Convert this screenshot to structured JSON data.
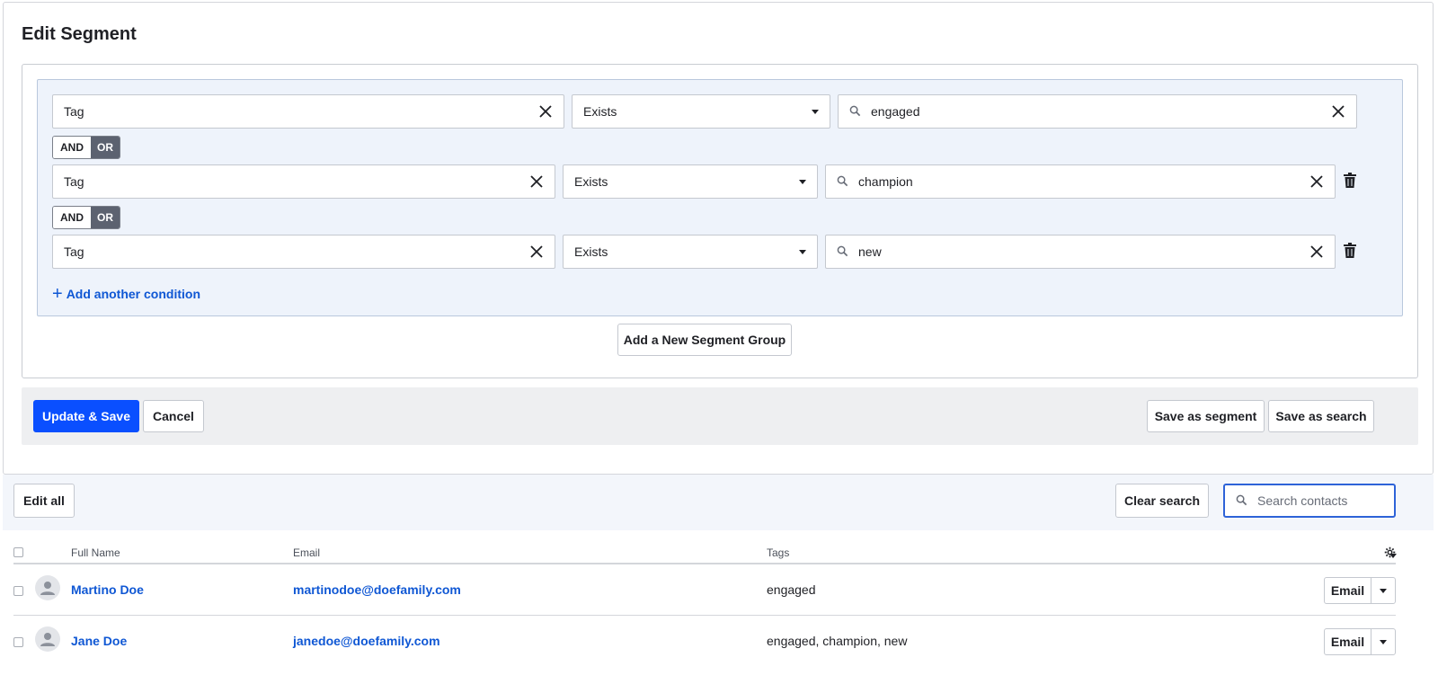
{
  "panel": {
    "title": "Edit Segment"
  },
  "conditions": [
    {
      "field": "Tag",
      "operator": "Exists",
      "value": "engaged"
    },
    {
      "field": "Tag",
      "operator": "Exists",
      "value": "champion"
    },
    {
      "field": "Tag",
      "operator": "Exists",
      "value": "new"
    }
  ],
  "logic": {
    "and_label": "AND",
    "or_label": "OR",
    "selected": "OR"
  },
  "add_condition_label": "Add another condition",
  "add_group_label": "Add a New Segment Group",
  "footer": {
    "update_label": "Update & Save",
    "cancel_label": "Cancel",
    "save_segment_label": "Save as segment",
    "save_search_label": "Save as search"
  },
  "toolbar": {
    "edit_all_label": "Edit all",
    "clear_search_label": "Clear search",
    "search_placeholder": "Search contacts"
  },
  "table": {
    "columns": {
      "name": "Full Name",
      "email": "Email",
      "tags": "Tags"
    },
    "rows": [
      {
        "name": "Martino Doe",
        "email": "martinodoe@doefamily.com",
        "tags": "engaged",
        "action": "Email"
      },
      {
        "name": "Jane Doe",
        "email": "janedoe@doefamily.com",
        "tags": "engaged, champion, new",
        "action": "Email"
      }
    ]
  },
  "colors": {
    "primary": "#0a4fff",
    "link": "#0f57d4",
    "group_bg": "#eef3fb",
    "or_active": "#5c6270"
  }
}
